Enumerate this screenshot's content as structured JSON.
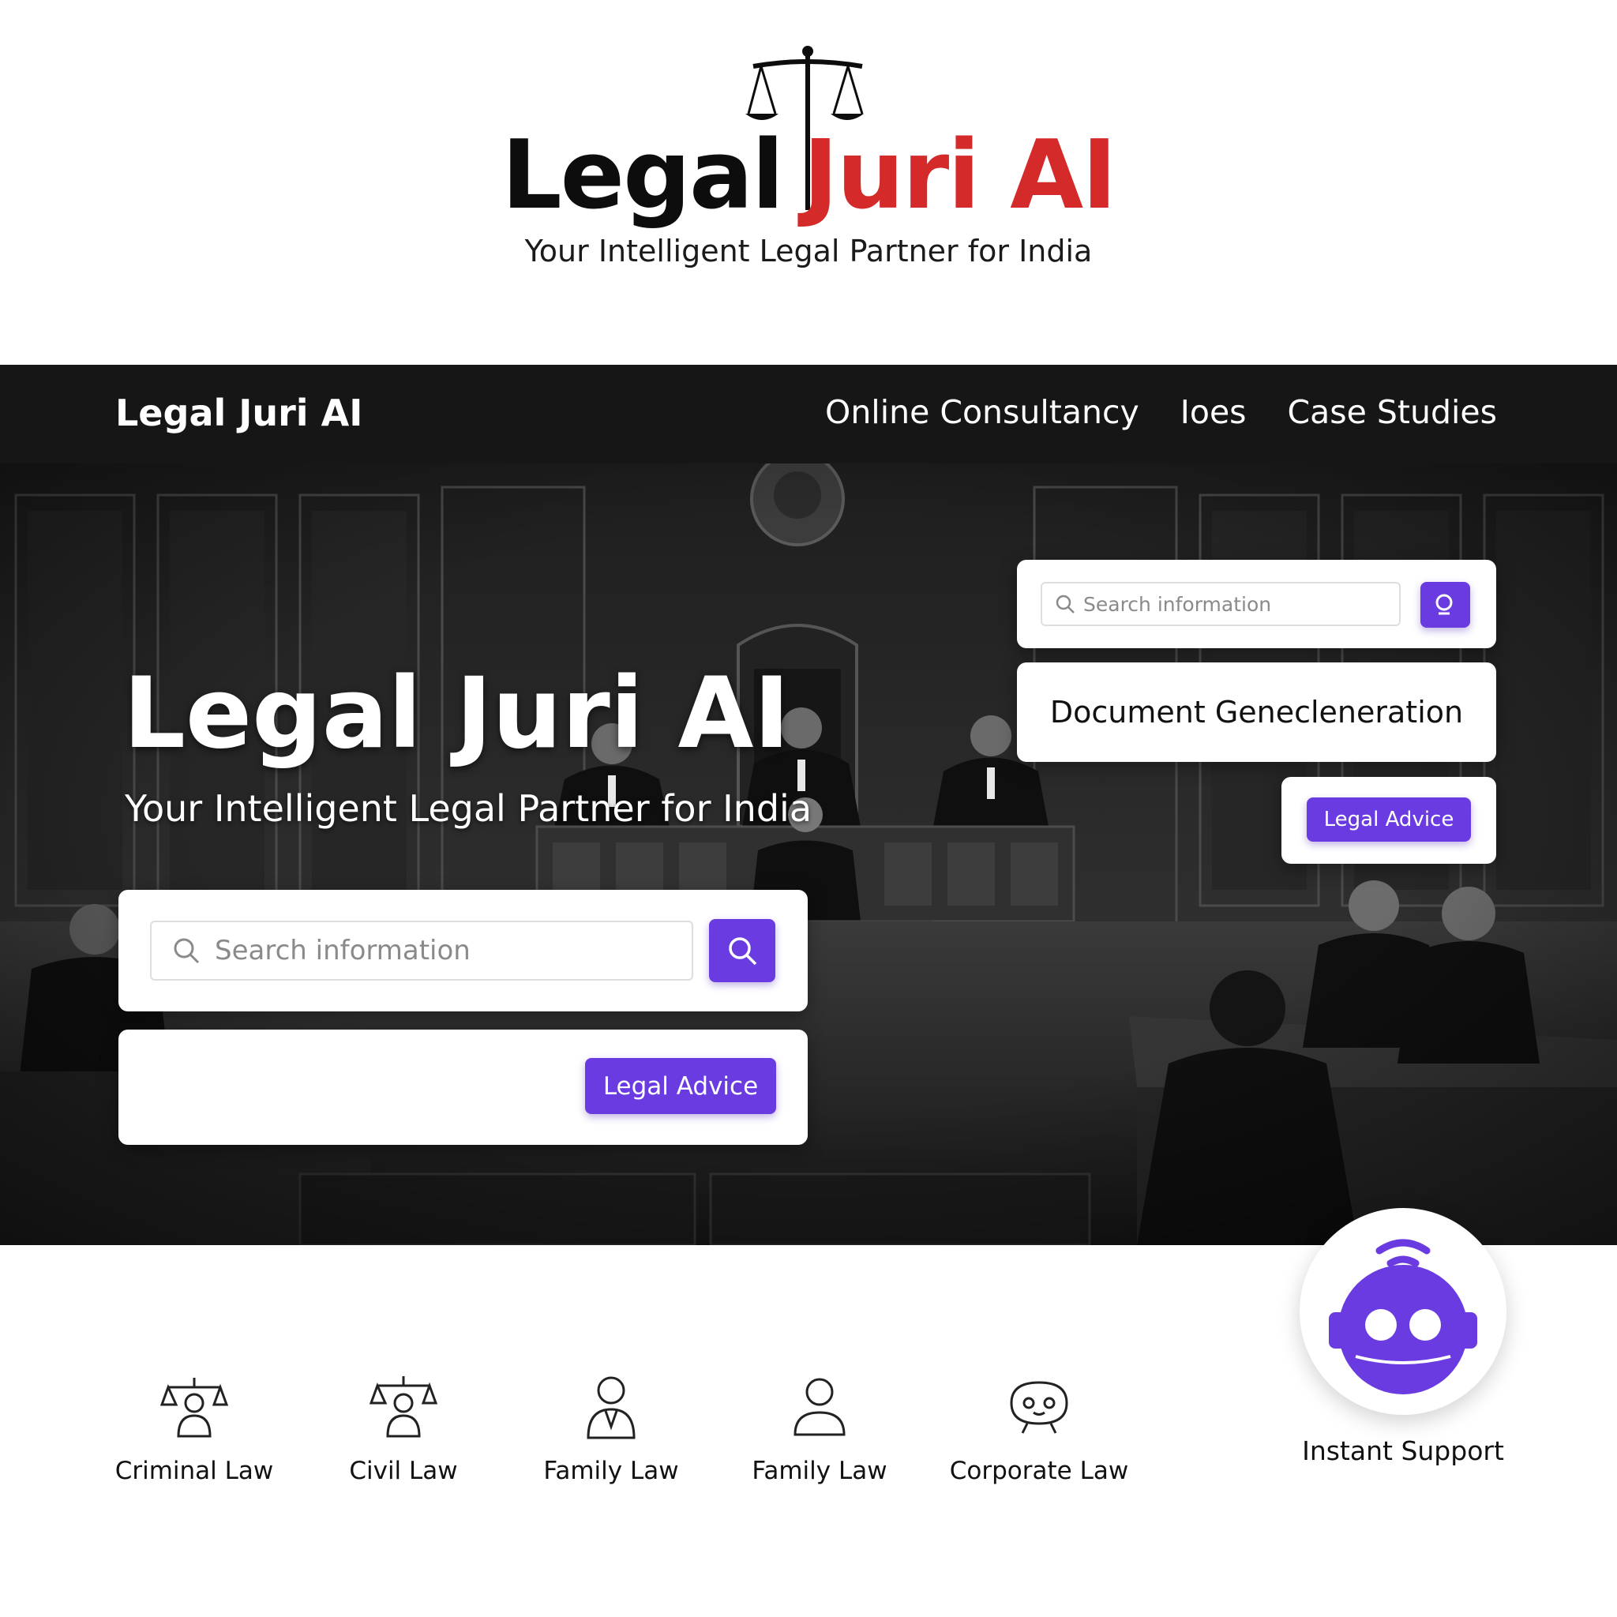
{
  "brand": {
    "wordmark_a": "Legal",
    "wordmark_b": "Juri AI",
    "tagline": "Your Intelligent Legal Partner for India",
    "colors": {
      "dark": "#0d0d0d",
      "red": "#d42a2a",
      "accent": "#6a3be0"
    }
  },
  "nav": {
    "logo": "Legal Juri AI",
    "links": [
      "Online Consultancy",
      "Ioes",
      "Case Studies"
    ]
  },
  "hero": {
    "title": "Legal Juri AI",
    "tagline": "Your Intelligent Legal Partner for India",
    "search_right": {
      "placeholder": "Search information",
      "button_icon": "search-icon"
    },
    "doc_card": {
      "label": "Document Genecleneration"
    },
    "advice_right": {
      "label": "Legal Advice"
    },
    "search_left": {
      "placeholder": "Search information",
      "button_icon": "search-icon"
    },
    "advice_left": {
      "label": "Legal Advice"
    }
  },
  "categories": [
    {
      "label": "Criminal Law",
      "icon": "scales-person-icon"
    },
    {
      "label": "Civil Law",
      "icon": "scales-person-icon"
    },
    {
      "label": "Family Law",
      "icon": "lawyer-icon"
    },
    {
      "label": "Family Law",
      "icon": "person-icon"
    },
    {
      "label": "Corporate Law",
      "icon": "robot-face-icon"
    }
  ],
  "support": {
    "label": "Instant Support",
    "icon": "chatbot-icon"
  }
}
